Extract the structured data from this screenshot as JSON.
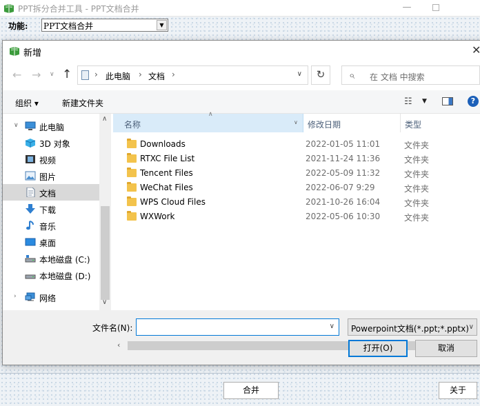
{
  "main_window": {
    "title": "PPT拆分合并工具 - PPT文档合并",
    "function_label": "功能:",
    "function_value": "PPT文档合并",
    "merge_button": "合并",
    "about_button": "关于"
  },
  "dialog": {
    "title": "新增",
    "breadcrumbs": [
      "此电脑",
      "文档"
    ],
    "search_placeholder": "在 文档 中搜索",
    "toolbar": {
      "organize": "组织 ▾",
      "new_folder": "新建文件夹"
    },
    "nav_tree": [
      {
        "label": "此电脑",
        "icon": "computer-icon"
      },
      {
        "label": "3D 对象",
        "icon": "cube-icon"
      },
      {
        "label": "视频",
        "icon": "video-icon"
      },
      {
        "label": "图片",
        "icon": "picture-icon"
      },
      {
        "label": "文档",
        "icon": "document-icon",
        "selected": true
      },
      {
        "label": "下载",
        "icon": "download-icon"
      },
      {
        "label": "音乐",
        "icon": "music-icon"
      },
      {
        "label": "桌面",
        "icon": "desktop-icon"
      },
      {
        "label": "本地磁盘 (C:)",
        "icon": "drive-icon"
      },
      {
        "label": "本地磁盘 (D:)",
        "icon": "drive-icon"
      },
      {
        "label": "网络",
        "icon": "network-icon"
      }
    ],
    "columns": {
      "name": "名称",
      "date": "修改日期",
      "type": "类型"
    },
    "files": [
      {
        "name": "Downloads",
        "date": "2022-01-05 11:01",
        "type": "文件夹"
      },
      {
        "name": "RTXC File List",
        "date": "2021-11-24 11:36",
        "type": "文件夹"
      },
      {
        "name": "Tencent Files",
        "date": "2022-05-09 11:32",
        "type": "文件夹"
      },
      {
        "name": "WeChat Files",
        "date": "2022-06-07 9:29",
        "type": "文件夹"
      },
      {
        "name": "WPS Cloud Files",
        "date": "2021-10-26 16:04",
        "type": "文件夹"
      },
      {
        "name": "WXWork",
        "date": "2022-05-06 10:30",
        "type": "文件夹"
      }
    ],
    "filename_label": "文件名(N):",
    "filename_value": "",
    "filetype_value": "Powerpoint文档(*.ppt;*.pptx)",
    "open_button": "打开(O)",
    "cancel_button": "取消"
  }
}
